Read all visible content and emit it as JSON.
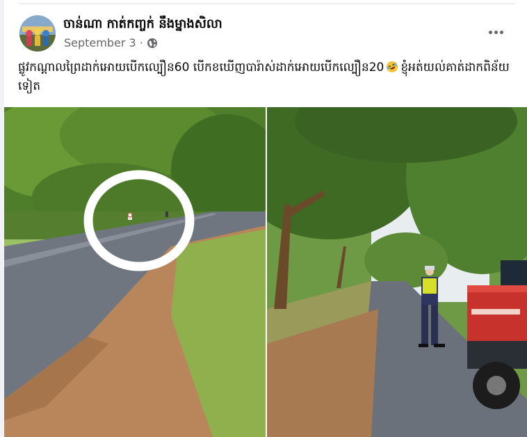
{
  "post": {
    "author": "ចាន់ណា កាត់កញ្ចក់ នឹងម្នាងសិលា",
    "date": "September 3",
    "separator": "·",
    "audience_icon": "globe-icon",
    "more_icon": "more-options-icon",
    "text_part1": "ផ្លូវកណ្ដាលព្រៃដាក់អោយបើកល្បឿន60  បើកខឃើញបារ៉ាស់ដាក់អោយបើកល្បឿន20",
    "emoji_icon": "rolling-on-floor-laughing-emoji",
    "text_part2": "ខ្ញុំអត់យល់គាត់ដាកពិន័យទៀត"
  },
  "photos": [
    {
      "name": "road-photo-with-speed-sign-circled",
      "circle_annotation_color": "#ffffff"
    },
    {
      "name": "road-photo-with-traffic-officer-and-truck",
      "truck_color": "#c8322c",
      "officer_vest_color": "#d6e02a"
    }
  ],
  "colors": {
    "name_text": "#050505",
    "meta_text": "#65676b",
    "background": "#f0f2f5"
  }
}
